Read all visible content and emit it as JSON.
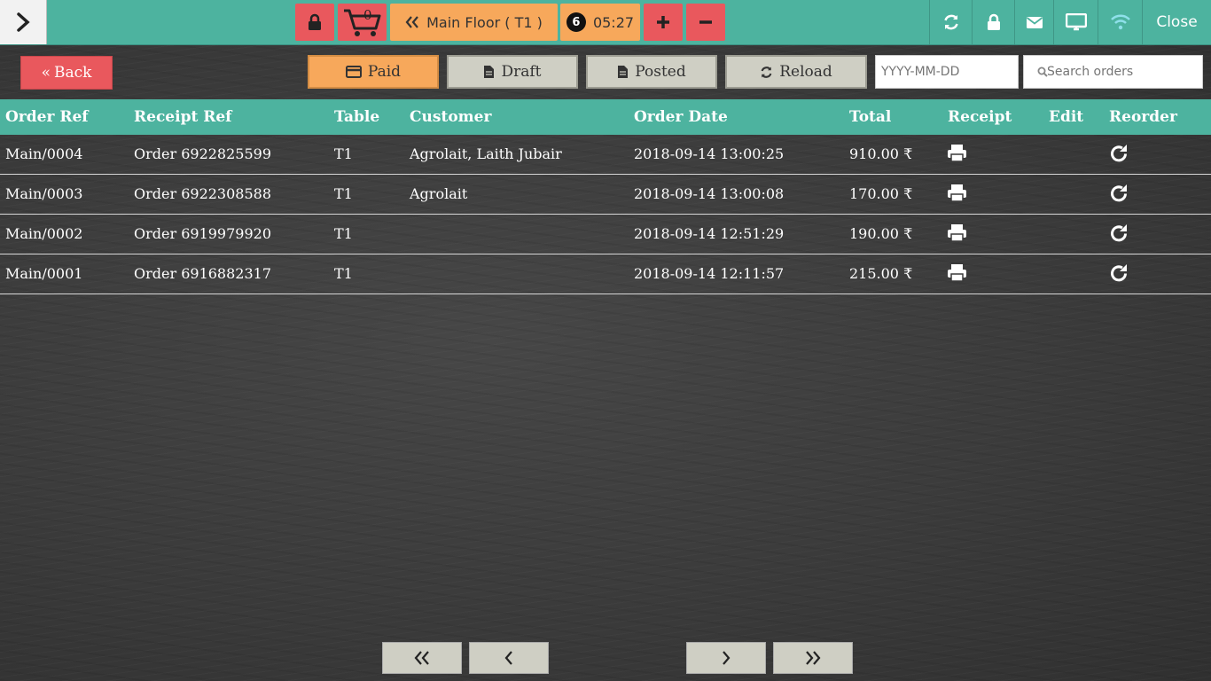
{
  "header": {
    "cart_count": "0",
    "floor_label": "Main Floor ( T1 )",
    "guests": "6",
    "timer": "05:27",
    "close_label": "Close"
  },
  "controls": {
    "back_label": "Back",
    "paid_label": "Paid",
    "draft_label": "Draft",
    "posted_label": "Posted",
    "reload_label": "Reload",
    "date_placeholder": "YYYY-MM-DD",
    "search_placeholder": "Search orders"
  },
  "table": {
    "headers": {
      "order_ref": "Order Ref",
      "receipt_ref": "Receipt Ref",
      "table": "Table",
      "customer": "Customer",
      "order_date": "Order Date",
      "total": "Total",
      "receipt": "Receipt",
      "edit": "Edit",
      "reorder": "Reorder"
    },
    "rows": [
      {
        "order_ref": "Main/0004",
        "receipt_ref": "Order 6922825599",
        "table": "T1",
        "customer": "Agrolait, Laith Jubair",
        "order_date": "2018-09-14 13:00:25",
        "total": "910.00 ₹"
      },
      {
        "order_ref": "Main/0003",
        "receipt_ref": "Order 6922308588",
        "table": "T1",
        "customer": "Agrolait",
        "order_date": "2018-09-14 13:00:08",
        "total": "170.00 ₹"
      },
      {
        "order_ref": "Main/0002",
        "receipt_ref": "Order 6919979920",
        "table": "T1",
        "customer": "",
        "order_date": "2018-09-14 12:51:29",
        "total": "190.00 ₹"
      },
      {
        "order_ref": "Main/0001",
        "receipt_ref": "Order 6916882317",
        "table": "T1",
        "customer": "",
        "order_date": "2018-09-14 12:11:57",
        "total": "215.00 ₹"
      }
    ]
  },
  "colors": {
    "accent": "#4db39f",
    "danger": "#e9585d",
    "highlight": "#f7a85b",
    "button_gray": "#cfcfc4"
  }
}
